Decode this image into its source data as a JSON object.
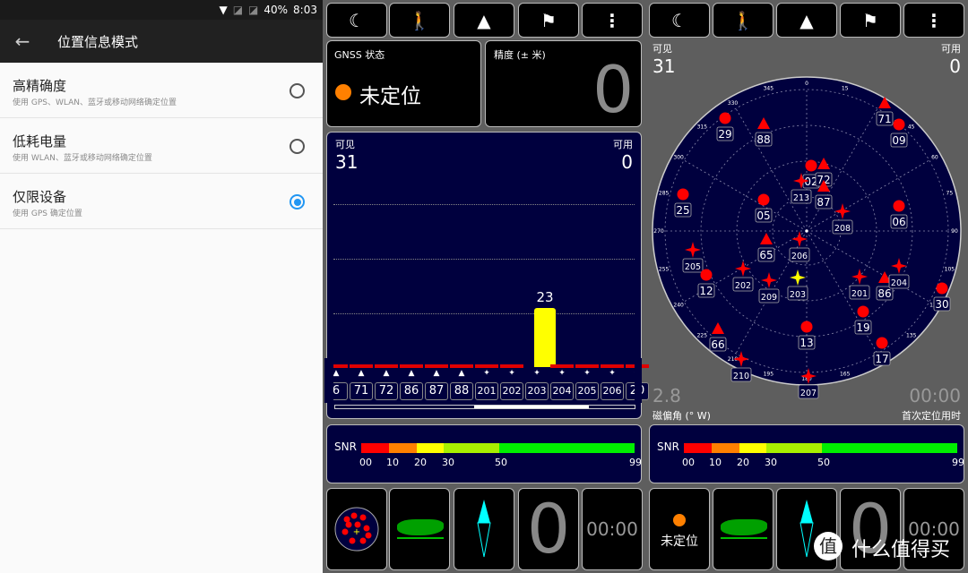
{
  "status_bar": {
    "battery": "40%",
    "time": "8:03",
    "icons": [
      "wifi-icon",
      "no-sim-icon",
      "no-sim-icon"
    ]
  },
  "settings": {
    "title": "位置信息模式",
    "back_icon": "arrow-left-icon",
    "options": [
      {
        "title": "高精确度",
        "subtitle": "使用 GPS、WLAN、蓝牙或移动网络确定位置",
        "selected": false
      },
      {
        "title": "低耗电量",
        "subtitle": "使用 WLAN、蓝牙或移动网络确定位置",
        "selected": false
      },
      {
        "title": "仅限设备",
        "subtitle": "使用 GPS 确定位置",
        "selected": true
      }
    ]
  },
  "toolbar": {
    "icons": [
      "night-mode-icon",
      "person-flag-icon",
      "navigation-arrow-icon",
      "flags-icon",
      "more-vert-icon"
    ]
  },
  "gnss": {
    "label": "GNSS 状态",
    "status": "未定位",
    "status_color": "#ff8000"
  },
  "accuracy": {
    "label": "精度 (± 米)",
    "value": "0"
  },
  "signal": {
    "visible_label": "可见",
    "visible": "31",
    "used_label": "可用",
    "used": "0",
    "bars": [
      {
        "id": "6",
        "type": "triangle",
        "snr": 0
      },
      {
        "id": "71",
        "type": "triangle",
        "snr": 0
      },
      {
        "id": "72",
        "type": "triangle",
        "snr": 0
      },
      {
        "id": "86",
        "type": "triangle",
        "snr": 0
      },
      {
        "id": "87",
        "type": "triangle",
        "snr": 0
      },
      {
        "id": "88",
        "type": "triangle",
        "snr": 0
      },
      {
        "id": "201",
        "type": "star",
        "snr": 0
      },
      {
        "id": "202",
        "type": "star",
        "snr": 0
      },
      {
        "id": "203",
        "type": "star",
        "snr": 23
      },
      {
        "id": "204",
        "type": "star",
        "snr": 0
      },
      {
        "id": "205",
        "type": "star",
        "snr": 0
      },
      {
        "id": "206",
        "type": "star",
        "snr": 0
      },
      {
        "id": "20",
        "type": "star",
        "snr": 0
      }
    ],
    "bar_value_label": "23"
  },
  "snr": {
    "label": "SNR",
    "ticks": [
      "00",
      "10",
      "20",
      "30",
      "50",
      "99"
    ],
    "colors": [
      "#ff0000",
      "#ff8000",
      "#ffff00",
      "#a8f000",
      "#00f000"
    ]
  },
  "sky": {
    "visible_label": "可见",
    "visible": "31",
    "used_label": "可用",
    "used": "0",
    "azimuth_labels": [
      "0",
      "15",
      "45",
      "60",
      "75",
      "90",
      "105",
      "120",
      "135",
      "165",
      "180",
      "195",
      "210",
      "225",
      "240",
      "255",
      "270",
      "285",
      "300",
      "315",
      "330",
      "345"
    ],
    "declination": "2.8",
    "declination_label": "磁偏角 (° W)",
    "ttff": "00:00",
    "ttff_label": "首次定位用时",
    "satellites": [
      {
        "id": "29",
        "type": "circle"
      },
      {
        "id": "88",
        "type": "triangle"
      },
      {
        "id": "71",
        "type": "triangle"
      },
      {
        "id": "09",
        "type": "circle"
      },
      {
        "id": "02",
        "type": "circle"
      },
      {
        "id": "72",
        "type": "triangle"
      },
      {
        "id": "213",
        "type": "star"
      },
      {
        "id": "87",
        "type": "triangle"
      },
      {
        "id": "25",
        "type": "circle"
      },
      {
        "id": "05",
        "type": "circle"
      },
      {
        "id": "06",
        "type": "circle"
      },
      {
        "id": "208",
        "type": "star"
      },
      {
        "id": "65",
        "type": "triangle"
      },
      {
        "id": "206",
        "type": "star"
      },
      {
        "id": "205",
        "type": "star"
      },
      {
        "id": "12",
        "type": "circle"
      },
      {
        "id": "202",
        "type": "star"
      },
      {
        "id": "209",
        "type": "star"
      },
      {
        "id": "203",
        "type": "star",
        "highlight": true
      },
      {
        "id": "201",
        "type": "star"
      },
      {
        "id": "86",
        "type": "triangle"
      },
      {
        "id": "204",
        "type": "star"
      },
      {
        "id": "30",
        "type": "circle"
      },
      {
        "id": "19",
        "type": "circle"
      },
      {
        "id": "13",
        "type": "circle"
      },
      {
        "id": "17",
        "type": "circle"
      },
      {
        "id": "66",
        "type": "triangle"
      },
      {
        "id": "210",
        "type": "star"
      },
      {
        "id": "207",
        "type": "star"
      }
    ]
  },
  "bottom_left": {
    "tiles": [
      "sky-thumb-icon",
      "world-map-icon",
      "compass-icon"
    ],
    "speed": "0",
    "time": "00:00"
  },
  "bottom_right": {
    "status": "未定位",
    "speed": "0",
    "time": "00:00"
  },
  "watermark": {
    "badge": "值",
    "text": "什么值得买"
  }
}
